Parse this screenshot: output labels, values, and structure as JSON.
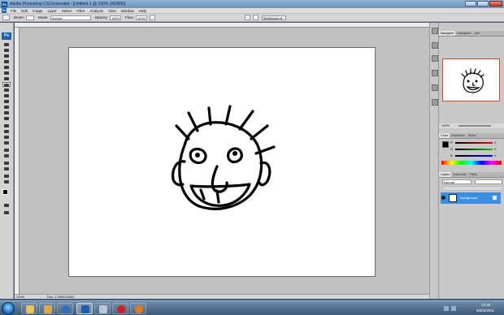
{
  "window": {
    "title": "Adobe Photoshop CS3 Extended - [Untitled-1 @ 100% (RGB/8)]"
  },
  "menu": [
    "File",
    "Edit",
    "Image",
    "Layer",
    "Select",
    "Filter",
    "Analysis",
    "View",
    "Window",
    "Help"
  ],
  "options": {
    "brush_label": "Brush:",
    "mode_label": "Mode:",
    "mode_value": "Normal",
    "opacity_label": "Opacity:",
    "opacity_value": "100%",
    "flow_label": "Flow:",
    "flow_value": "100%",
    "workspace_label": "Workspace ▾"
  },
  "status": {
    "zoom": "100%",
    "doc": "Doc: 2.29M/3.84M"
  },
  "navigator": {
    "tabs": [
      "Navigator",
      "Histogram",
      "Info"
    ],
    "zoom": "100%"
  },
  "color_panel": {
    "tabs": [
      "Color",
      "Swatches",
      "Styles"
    ],
    "channels": [
      {
        "label": "R",
        "value": "0"
      },
      {
        "label": "G",
        "value": "0"
      },
      {
        "label": "B",
        "value": "0"
      }
    ]
  },
  "layers_panel": {
    "tabs": [
      "Layers",
      "Channels",
      "Paths"
    ],
    "blend_mode": "Normal",
    "layer_name": "Background"
  },
  "taskbar": {
    "time": "13:25",
    "date": "26/02/2011"
  },
  "colors": {
    "accent": "#1f5fb0",
    "selection": "#3a8ee6"
  }
}
